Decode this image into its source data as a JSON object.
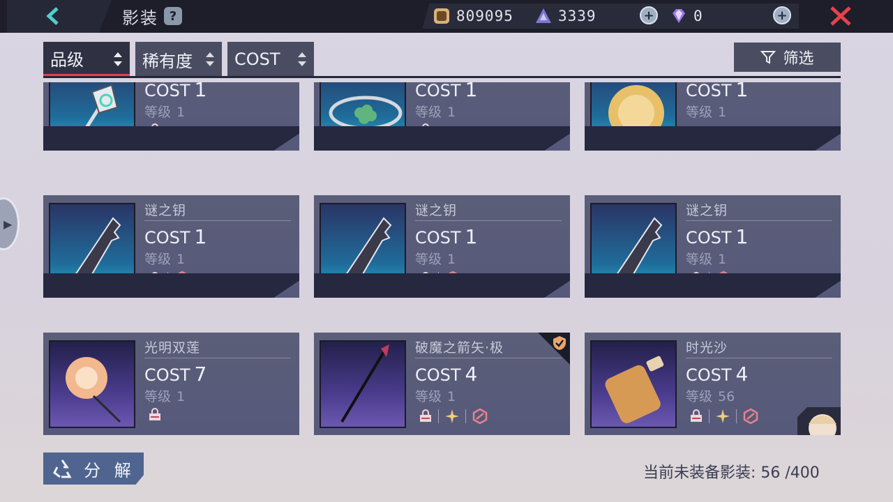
{
  "header": {
    "title": "影装",
    "help": "?",
    "gold": "809095",
    "crystal": "3339",
    "gems": "0"
  },
  "sort": {
    "items": [
      "品级",
      "稀有度",
      "COST"
    ],
    "active_index": 0,
    "filter_label": "筛选"
  },
  "cards": [
    {
      "name": "",
      "cost_label": "COST",
      "cost": "1",
      "level_label": "等级",
      "level": "1",
      "icons": [
        "lock-icon"
      ]
    },
    {
      "name": "",
      "cost_label": "COST",
      "cost": "1",
      "level_label": "等级",
      "level": "1",
      "icons": [
        "lock-icon"
      ]
    },
    {
      "name": "",
      "cost_label": "COST",
      "cost": "1",
      "level_label": "等级",
      "level": "1",
      "icons": []
    },
    {
      "name": "谜之钥",
      "cost_label": "COST",
      "cost": "1",
      "level_label": "等级",
      "level": "1",
      "icons": [
        "lock-icon",
        "forbid-icon"
      ]
    },
    {
      "name": "谜之钥",
      "cost_label": "COST",
      "cost": "1",
      "level_label": "等级",
      "level": "1",
      "icons": [
        "lock-icon",
        "forbid-icon"
      ]
    },
    {
      "name": "谜之钥",
      "cost_label": "COST",
      "cost": "1",
      "level_label": "等级",
      "level": "1",
      "icons": [
        "lock-icon",
        "forbid-icon"
      ]
    },
    {
      "name": "光明双莲",
      "cost_label": "COST",
      "cost": "7",
      "level_label": "等级",
      "level": "1",
      "icons": [
        "lock-icon"
      ]
    },
    {
      "name": "破魔之箭矢·极",
      "cost_label": "COST",
      "cost": "4",
      "level_label": "等级",
      "level": "1",
      "icons": [
        "lock-icon",
        "star-icon",
        "forbid-icon"
      ]
    },
    {
      "name": "时光沙",
      "cost_label": "COST",
      "cost": "4",
      "level_label": "等级",
      "level": "56",
      "icons": [
        "lock-icon",
        "star-icon",
        "forbid-icon"
      ]
    }
  ],
  "footer": {
    "decompose_label": "分 解",
    "count_text": "当前未装备影装: 56 /400"
  },
  "colors": {
    "accent": "#e04452",
    "bar": "#1d1e2a",
    "card": "#5b5e78"
  }
}
